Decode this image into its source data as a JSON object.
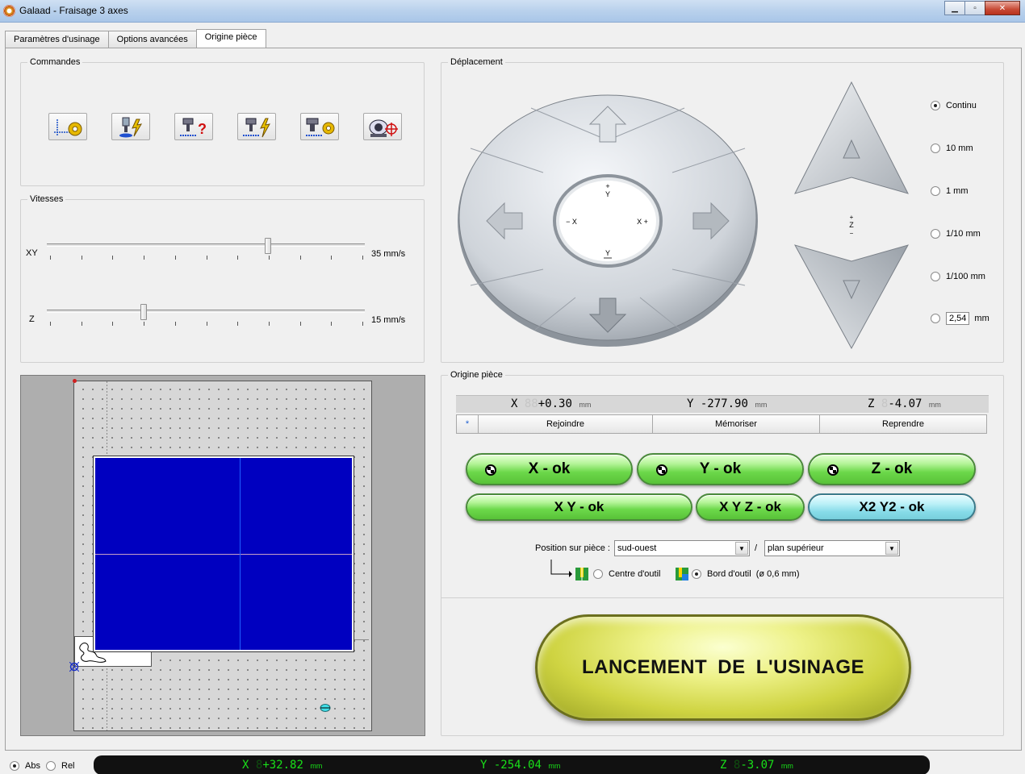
{
  "window": {
    "title": "Galaad  -  Fraisage 3 axes"
  },
  "tabs": [
    {
      "label": "Paramètres d'usinage"
    },
    {
      "label": "Options avancées"
    },
    {
      "label": "Origine pièce",
      "active": true
    }
  ],
  "commandes": {
    "legend": "Commandes",
    "buttons": [
      "axes-config-icon",
      "probe-lightning-icon",
      "tool-question-icon",
      "tool-lightning-icon",
      "tool-gear-icon",
      "camera-target-icon"
    ]
  },
  "vitesses": {
    "legend": "Vitesses",
    "xy": {
      "label": "XY",
      "value": "35 mm/s",
      "position": 0.7
    },
    "z": {
      "label": "Z",
      "value": "15 mm/s",
      "position": 0.3
    }
  },
  "deplacement": {
    "legend": "Déplacement",
    "labels": {
      "plus_y": "+\nY",
      "minus_y": "Y",
      "minus_x": "− X",
      "plus_x": "X +",
      "z": "+\nZ\n−"
    },
    "steps": [
      {
        "label": "Continu",
        "selected": true
      },
      {
        "label": "10 mm",
        "selected": false
      },
      {
        "label": "1 mm",
        "selected": false
      },
      {
        "label": "1/10 mm",
        "selected": false
      },
      {
        "label": "1/100 mm",
        "selected": false
      }
    ],
    "custom": {
      "value": "2,54",
      "unit": "mm"
    }
  },
  "origine": {
    "legend": "Origine pièce",
    "coords": {
      "x": {
        "axis": "X",
        "ghost": "88",
        "value": "+0.30",
        "unit": "mm"
      },
      "y": {
        "axis": "Y",
        "ghost": "",
        "value": "-277.90",
        "unit": "mm"
      },
      "z": {
        "axis": "Z",
        "ghost": "8",
        "value": "-4.07",
        "unit": "mm"
      }
    },
    "star": "*",
    "actions": {
      "rejoindre": "Rejoindre",
      "memoriser": "Mémoriser",
      "reprendre": "Reprendre"
    },
    "ok": {
      "x": "X - ok",
      "y": "Y - ok",
      "z": "Z - ok",
      "xy": "X Y - ok",
      "xyz": "X Y Z - ok",
      "x2y2": "X2 Y2 - ok"
    },
    "position_label": "Position sur pièce :",
    "position_value": "sud-ouest",
    "separator": "/",
    "plan_value": "plan supérieur",
    "centre_outil": "Centre d'outil",
    "bord_outil": "Bord d'outil",
    "diameter": "(ø 0,6 mm)"
  },
  "launch": {
    "label": "LANCEMENT  DE  L'USINAGE"
  },
  "status": {
    "abs": "Abs",
    "rel": "Rel",
    "x": {
      "axis": "X",
      "ghost": "8",
      "value": "+32.82",
      "unit": "mm"
    },
    "y": {
      "axis": "Y",
      "ghost": "",
      "value": "-254.04",
      "unit": "mm"
    },
    "z": {
      "axis": "Z",
      "ghost": "8",
      "value": "-3.07",
      "unit": "mm"
    }
  }
}
